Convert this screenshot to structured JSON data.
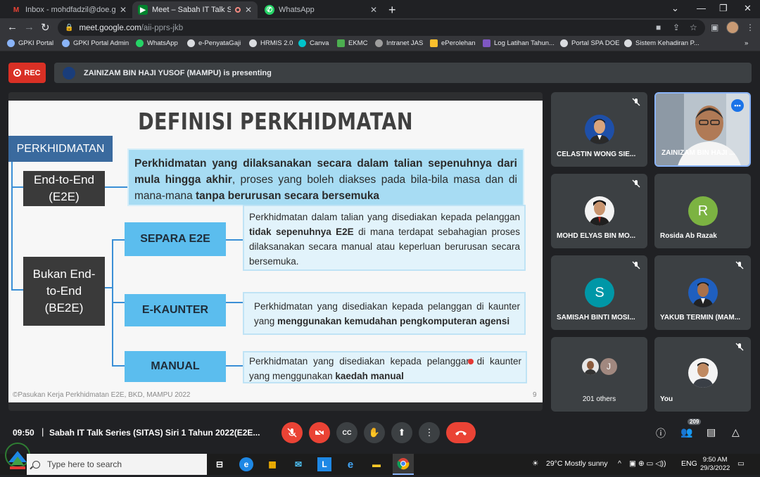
{
  "browser": {
    "tabs": [
      {
        "title": "Inbox - mohdfadzil@doe.gov.my",
        "icon": "gmail-icon"
      },
      {
        "title": "Meet – Sabah IT Talk Series (",
        "icon": "meet-icon"
      },
      {
        "title": "WhatsApp",
        "icon": "whatsapp-icon"
      }
    ],
    "url_host": "meet.google.com",
    "url_path": "/aii-pprs-jkb",
    "bookmarks": [
      "GPKI Portal",
      "GPKI Portal Admin",
      "WhatsApp",
      "e-PenyataGaji",
      "HRMIS 2.0",
      "Canva",
      "EKMC",
      "Intranet JAS",
      "ePerolehan",
      "Log Latihan Tahun...",
      "Portal SPA DOE",
      "Sistem Kehadiran P..."
    ]
  },
  "meet": {
    "rec_label": "REC",
    "presenting_text": "ZAINIZAM BIN HAJI YUSOF (MAMPU) is presenting",
    "time": "09:50",
    "meeting_title": "Sabah IT Talk Series (SITAS) Siri 1 Tahun 2022(E2E...",
    "people_count": "209"
  },
  "slide": {
    "title": "DEFINISI PERKHIDMATAN",
    "root_label": "PERKHIDMATAN",
    "e2e_label_1": "End-to-End",
    "e2e_label_2": "(E2E)",
    "e2e_desc_b1": "Perkhidmatan yang dilaksanakan secara dalam talian sepenuhnya dari mula hingga akhir",
    "e2e_desc_n1": ", proses yang boleh diakses pada bila-bila masa dan di mana-mana ",
    "e2e_desc_b2": "tanpa berurusan secara bersemuka",
    "be2e_label_1": "Bukan End-",
    "be2e_label_2": "to-End",
    "be2e_label_3": "(BE2E)",
    "separa_label": "SEPARA E2E",
    "separa_desc_n1": "Perkhidmatan dalam talian yang disediakan kepada pelanggan ",
    "separa_desc_b1": "tidak sepenuhnya E2E",
    "separa_desc_n2": " di mana terdapat sebahagian proses dilaksanakan secara manual atau keperluan berurusan secara bersemuka.",
    "ekaunter_label": "E-KAUNTER",
    "ekaunter_desc_n1": "Perkhidmatan yang disediakan kepada pelanggan di kaunter yang ",
    "ekaunter_desc_b1": "menggunakan kemudahan pengkomputeran agensi",
    "manual_label": "MANUAL",
    "manual_desc_n1": "Perkhidmatan yang disediakan kepada pelanggan di kaunter yang menggunakan ",
    "manual_desc_b1": "kaedah manual",
    "footer": "©Pasukan Kerja Perkhidmatan E2E, BKD, MAMPU 2022",
    "page_number": "9"
  },
  "participants": [
    {
      "name": "CELASTIN WONG SIE...",
      "kind": "photo"
    },
    {
      "name": "ZAINIZAM BIN HAJI ...",
      "kind": "video"
    },
    {
      "name": "MOHD ELYAS BIN MO...",
      "kind": "photo"
    },
    {
      "name": "Rosida Ab Razak",
      "kind": "letter",
      "letter": "R",
      "color": "#7cb342"
    },
    {
      "name": "SAMISAH BINTI MOSI...",
      "kind": "letter",
      "letter": "S",
      "color": "#0097a7"
    },
    {
      "name": "YAKUB TERMIN (MAM...",
      "kind": "photo"
    },
    {
      "name": "201 others",
      "kind": "group",
      "letter": "J"
    },
    {
      "name": "You",
      "kind": "photo"
    }
  ],
  "taskbar": {
    "search_placeholder": "Type here to search",
    "weather": "29°C  Mostly sunny",
    "lang": "ENG",
    "clock_time": "9:50 AM",
    "clock_date": "29/3/2022"
  }
}
